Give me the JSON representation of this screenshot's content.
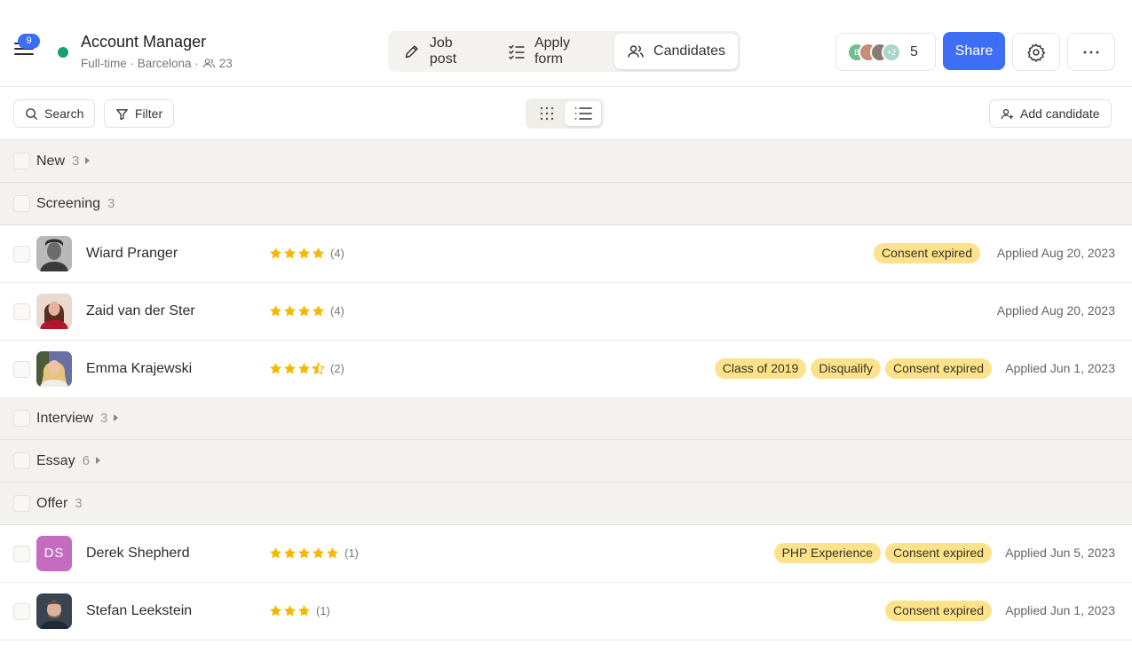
{
  "header": {
    "menu_badge": "9",
    "job_title": "Account Manager",
    "job_meta": "Full-time · Barcelona ·",
    "job_candidates_count": "23",
    "tabs": [
      {
        "label": "Job post",
        "icon": "pencil-icon"
      },
      {
        "label": "Apply form",
        "icon": "checklist-icon"
      },
      {
        "label": "Candidates",
        "icon": "users-icon",
        "active": true
      }
    ],
    "members": {
      "avatars": [
        "B",
        "",
        "",
        "+2"
      ],
      "count": "5"
    },
    "share_label": "Share"
  },
  "toolbar": {
    "search_label": "Search",
    "filter_label": "Filter",
    "add_candidate_label": "Add candidate"
  },
  "stages": [
    {
      "name": "New",
      "count": "3",
      "collapsed": true
    },
    {
      "name": "Screening",
      "count": "3",
      "collapsed": false
    },
    {
      "name": "Interview",
      "count": "3",
      "collapsed": true
    },
    {
      "name": "Essay",
      "count": "6",
      "collapsed": true
    },
    {
      "name": "Offer",
      "count": "3",
      "collapsed": false
    }
  ],
  "candidates": [
    {
      "name": "Wiard Pranger",
      "stars": 4,
      "rating_count": "(4)",
      "tags": [
        "Consent expired"
      ],
      "applied": "Applied Aug 20, 2023",
      "avatar": "photo-gray"
    },
    {
      "name": "Zaid van der Ster",
      "stars": 4,
      "rating_count": "(4)",
      "tags": [],
      "applied": "Applied Aug 20, 2023",
      "avatar": "photo-red"
    },
    {
      "name": "Emma Krajewski",
      "stars": 3.5,
      "rating_count": "(2)",
      "tags": [
        "Class of 2019",
        "Disqualify",
        "Consent expired"
      ],
      "applied": "Applied Jun 1, 2023",
      "avatar": "photo-blonde"
    },
    {
      "name": "Derek Shepherd",
      "stars": 5,
      "rating_count": "(1)",
      "tags": [
        "PHP Experience",
        "Consent expired"
      ],
      "applied": "Applied Jun 5, 2023",
      "avatar": "initials",
      "initials": "DS"
    },
    {
      "name": "Stefan Leekstein",
      "stars": 3,
      "rating_count": "(1)",
      "tags": [
        "Consent expired"
      ],
      "applied": "Applied Jun 1, 2023",
      "avatar": "photo-dark"
    }
  ],
  "colors": {
    "accent": "#3d6ef4",
    "status_green": "#18a06b",
    "star": "#f5b800",
    "tag_bg": "#fbe28b",
    "stage_bg": "#f4f2ee",
    "initials_avatar": "#c56bc0"
  }
}
